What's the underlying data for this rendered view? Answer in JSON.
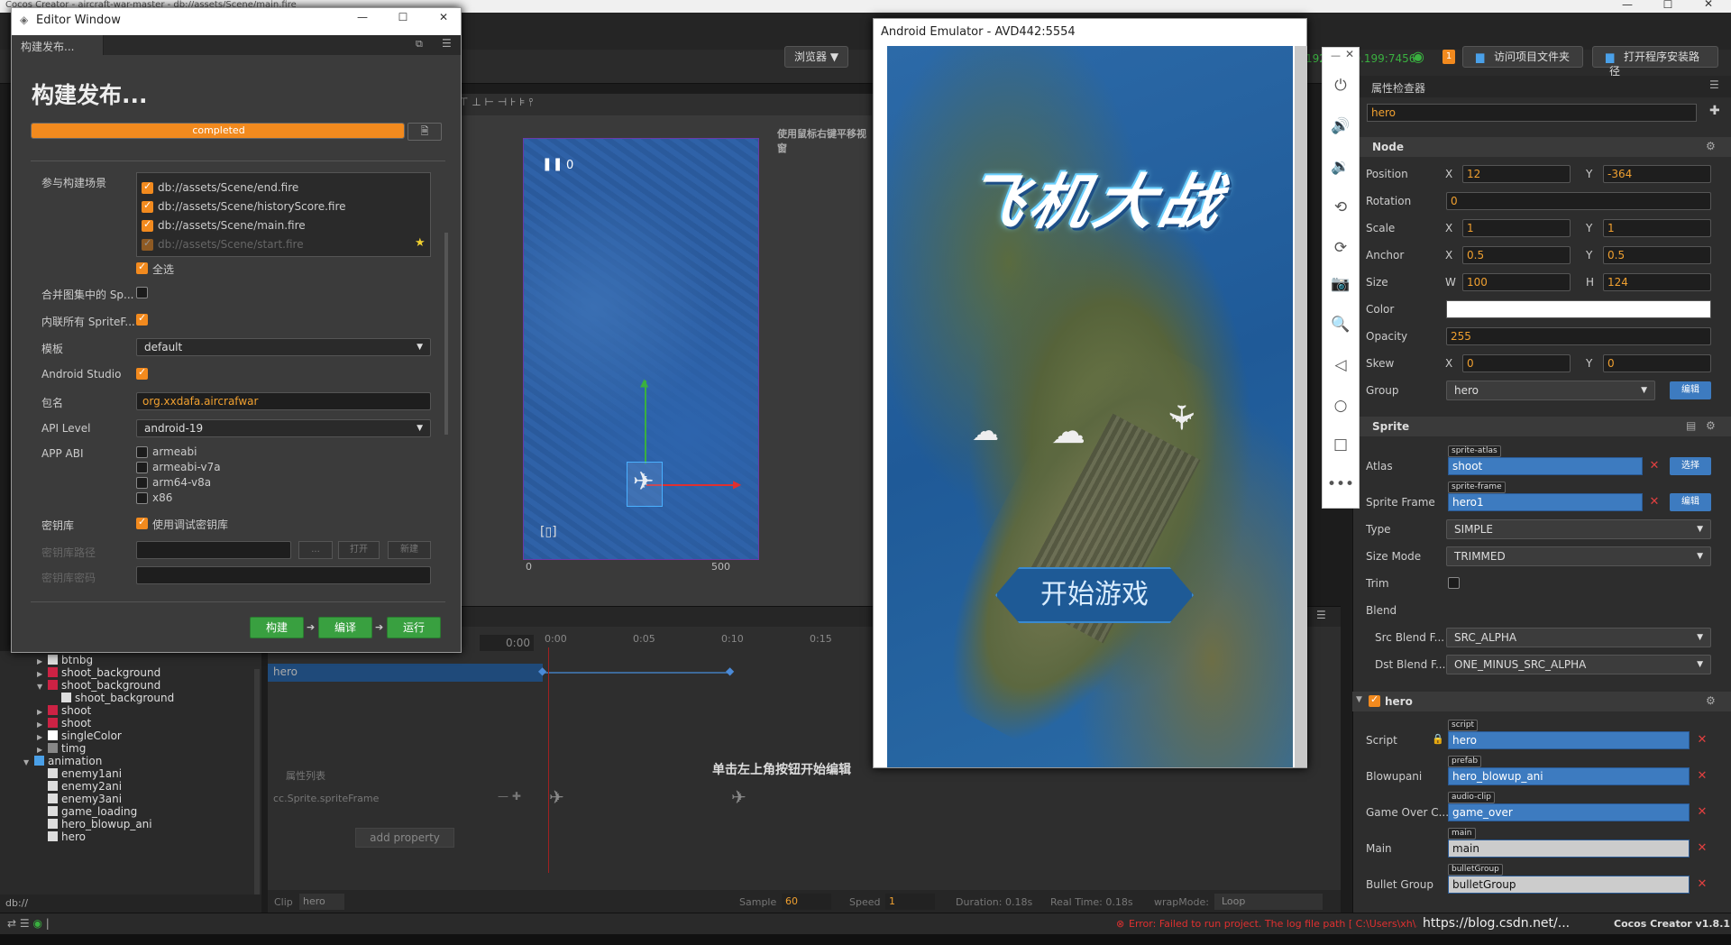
{
  "creator": {
    "title": "Cocos Creator - aircraft-war-master - db://assets/Scene/main.fire",
    "toolbar": {
      "browser": "浏览器 ▼",
      "ip": "192.168.0.199:7456",
      "badge": "1",
      "open_project": "访问项目文件夹",
      "open_install": "打开程序安装路径"
    },
    "scene_hint": "使用鼠标右键平移视窗",
    "scene_ruler": [
      "0",
      "500"
    ],
    "pause_count": "0"
  },
  "editor_window": {
    "title": "Editor Window",
    "tab": "构建发布...",
    "heading": "构建发布...",
    "progress": {
      "label": "completed",
      "value": 1.0
    },
    "scenes_label": "参与构建场景",
    "scenes": [
      {
        "path": "db://assets/Scene/end.fire",
        "checked": true
      },
      {
        "path": "db://assets/Scene/historyScore.fire",
        "checked": true
      },
      {
        "path": "db://assets/Scene/main.fire",
        "checked": true
      },
      {
        "path": "db://assets/Scene/start.fire",
        "checked": true
      }
    ],
    "select_all": "全选",
    "merge_label": "合并图集中的 Sp...",
    "inline_label": "内联所有 SpriteF...",
    "template_label": "模板",
    "template_value": "default",
    "android_studio_label": "Android Studio",
    "package_label": "包名",
    "package_value": "org.xxdafa.aircrafwar",
    "api_label": "API Level",
    "api_value": "android-19",
    "abi_label": "APP ABI",
    "abis": [
      "armeabi",
      "armeabi-v7a",
      "arm64-v8a",
      "x86"
    ],
    "keystore_label": "密钥库",
    "keystore_debug": "使用调试密钥库",
    "keystore_path_label": "密钥库路径",
    "keystore_pwd_label": "密钥库密码",
    "ellipsis_btn": "...",
    "open_btn": "打开",
    "new_btn": "新建",
    "build_btn": "构建",
    "compile_btn": "编译",
    "run_btn": "运行"
  },
  "emulator": {
    "title": "Android Emulator - AVD442:5554",
    "game_title": "飞机大战",
    "start_button": "开始游戏",
    "side_icons": [
      "power-icon",
      "volume-up-icon",
      "volume-down-icon",
      "rotate-left-icon",
      "rotate-right-icon",
      "camera-icon",
      "zoom-icon",
      "back-icon",
      "home-icon",
      "overview-icon",
      "more-icon"
    ]
  },
  "timeline": {
    "time": "0:00",
    "ticks": [
      "0:00",
      "0:05",
      "0:10",
      "0:15"
    ],
    "node": "hero",
    "hint": "单击左上角按钮开始编辑",
    "prop_list": "属性列表",
    "prop": "cc.Sprite.spriteFrame",
    "add_property": "add property",
    "clip_label": "Clip",
    "clip_value": "hero",
    "sample_label": "Sample",
    "sample_value": "60",
    "speed_label": "Speed",
    "speed_value": "1",
    "duration": "Duration: 0.18s",
    "realtime": "Real Time: 0.18s",
    "wrap_label": "wrapMode:",
    "wrap_value": "Loop"
  },
  "assets": {
    "items": [
      {
        "label": "btnbg",
        "indent": 1,
        "arrow": "▶"
      },
      {
        "label": "shoot_background",
        "indent": 1,
        "arrow": "▶"
      },
      {
        "label": "shoot_background",
        "indent": 1,
        "arrow": "▼"
      },
      {
        "label": "shoot_background",
        "indent": 2,
        "arrow": ""
      },
      {
        "label": "shoot",
        "indent": 1,
        "arrow": "▶"
      },
      {
        "label": "shoot",
        "indent": 1,
        "arrow": "▶"
      },
      {
        "label": "singleColor",
        "indent": 1,
        "arrow": "▶"
      },
      {
        "label": "timg",
        "indent": 1,
        "arrow": "▶"
      },
      {
        "label": "animation",
        "indent": 0,
        "arrow": "▼"
      },
      {
        "label": "enemy1ani",
        "indent": 1,
        "arrow": ""
      },
      {
        "label": "enemy2ani",
        "indent": 1,
        "arrow": ""
      },
      {
        "label": "enemy3ani",
        "indent": 1,
        "arrow": ""
      },
      {
        "label": "game_loading",
        "indent": 1,
        "arrow": ""
      },
      {
        "label": "hero_blowup_ani",
        "indent": 1,
        "arrow": ""
      },
      {
        "label": "hero",
        "indent": 1,
        "arrow": ""
      }
    ],
    "path": "db://"
  },
  "inspector": {
    "tab": "属性检查器",
    "node_name": "hero",
    "node_section": "Node",
    "position": {
      "label": "Position",
      "x": "12",
      "y": "-364"
    },
    "rotation": {
      "label": "Rotation",
      "value": "0"
    },
    "scale": {
      "label": "Scale",
      "x": "1",
      "y": "1"
    },
    "anchor": {
      "label": "Anchor",
      "x": "0.5",
      "y": "0.5"
    },
    "size": {
      "label": "Size",
      "w": "100",
      "h": "124"
    },
    "color_label": "Color",
    "opacity": {
      "label": "Opacity",
      "value": "255"
    },
    "skew": {
      "label": "Skew",
      "x": "0",
      "y": "0"
    },
    "group": {
      "label": "Group",
      "value": "hero",
      "edit": "编辑"
    },
    "sprite_section": "Sprite",
    "atlas": {
      "label": "Atlas",
      "tag": "sprite-atlas",
      "value": "shoot",
      "btn": "选择"
    },
    "sprite_frame": {
      "label": "Sprite Frame",
      "tag": "sprite-frame",
      "value": "hero1",
      "btn": "编辑"
    },
    "type": {
      "label": "Type",
      "value": "SIMPLE"
    },
    "size_mode": {
      "label": "Size Mode",
      "value": "TRIMMED"
    },
    "trim_label": "Trim",
    "blend_label": "Blend",
    "src_blend": {
      "label": "Src Blend F...",
      "value": "SRC_ALPHA"
    },
    "dst_blend": {
      "label": "Dst Blend F...",
      "value": "ONE_MINUS_SRC_ALPHA"
    },
    "hero_section": "hero",
    "script": {
      "label": "Script",
      "tag": "script",
      "value": "hero"
    },
    "blowupani": {
      "label": "Blowupani",
      "tag": "prefab",
      "value": "hero_blowup_ani"
    },
    "game_over": {
      "label": "Game Over C...",
      "tag": "audio-clip",
      "value": "game_over"
    },
    "main": {
      "label": "Main",
      "tag": "main",
      "value": "main"
    },
    "bullet_group": {
      "label": "Bullet Group",
      "tag": "bulletGroup",
      "value": "bulletGroup"
    }
  },
  "status": {
    "error": "Error: Failed to run project. The log file path [ C:\\Users\\xh\\...",
    "watermark": "https://blog.csdn.net/...",
    "version": "Cocos Creator v1.8.1"
  },
  "colors": {
    "accent": "#f28a1e",
    "green": "#39a040",
    "blue": "#3d7bc0",
    "error": "#e03030"
  }
}
